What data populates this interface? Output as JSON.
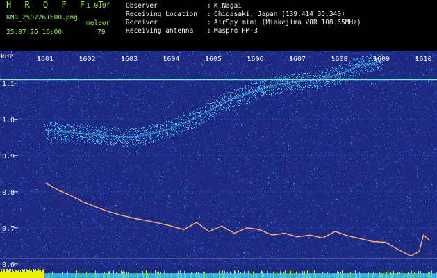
{
  "header": {
    "app_title": "H R O F F T",
    "app_version": "1.0.0f",
    "file_name": "KN9_2507261600.png",
    "mode_label": "meleor",
    "date_time": "25.07.26 16:00",
    "count_value": "79"
  },
  "meta": [
    {
      "label": "Observer",
      "value": "K.Nagai"
    },
    {
      "label": "Receiving Location",
      "value": "Chigasaki, Japan (139.414 35.340)"
    },
    {
      "label": "Receiver",
      "value": "AirSpy mini (Miakejima VOR 108.65MHz)"
    },
    {
      "label": "Receiving antenna",
      "value": "Maspro FM-3"
    }
  ],
  "colors": {
    "background": "#1c2a82",
    "text_green": "#9ef05a",
    "text_white": "#f2f2f2",
    "carrier_line": "#6ff0c8",
    "level_bar": "#e6f000"
  },
  "chart_data": {
    "type": "heatmap",
    "yunit": "kHz",
    "x": [
      "1601",
      "1602",
      "1603",
      "1604",
      "1605",
      "1606",
      "1607",
      "1608",
      "1609",
      "1610"
    ],
    "y_ticks": [
      "1.1",
      "1.0",
      "0.9",
      "0.8",
      "0.7",
      "0.6"
    ],
    "ylim": [
      0.59,
      1.19
    ],
    "carrier_freq": 1.11,
    "doppler_trace": [
      [
        1601.0,
        0.825
      ],
      [
        1601.3,
        0.805
      ],
      [
        1601.6,
        0.79
      ],
      [
        1601.9,
        0.772
      ],
      [
        1602.2,
        0.758
      ],
      [
        1602.5,
        0.745
      ],
      [
        1602.8,
        0.735
      ],
      [
        1603.1,
        0.727
      ],
      [
        1603.4,
        0.72
      ],
      [
        1603.7,
        0.713
      ],
      [
        1604.0,
        0.705
      ],
      [
        1604.3,
        0.695
      ],
      [
        1604.6,
        0.715
      ],
      [
        1604.9,
        0.69
      ],
      [
        1605.2,
        0.705
      ],
      [
        1605.5,
        0.685
      ],
      [
        1605.8,
        0.7
      ],
      [
        1606.1,
        0.695
      ],
      [
        1606.4,
        0.68
      ],
      [
        1606.7,
        0.685
      ],
      [
        1607.0,
        0.675
      ],
      [
        1607.3,
        0.68
      ],
      [
        1607.6,
        0.672
      ],
      [
        1607.9,
        0.69
      ],
      [
        1608.2,
        0.678
      ],
      [
        1608.5,
        0.67
      ],
      [
        1608.8,
        0.662
      ],
      [
        1609.1,
        0.66
      ],
      [
        1609.4,
        0.64
      ],
      [
        1609.7,
        0.622
      ],
      [
        1609.9,
        0.635
      ],
      [
        1610.0,
        0.68
      ],
      [
        1610.15,
        0.665
      ]
    ],
    "upper_trace": [
      [
        1601.0,
        0.97
      ],
      [
        1601.5,
        0.965
      ],
      [
        1602.0,
        0.96
      ],
      [
        1602.5,
        0.955
      ],
      [
        1603.0,
        0.95
      ],
      [
        1603.5,
        0.96
      ],
      [
        1604.0,
        0.975
      ],
      [
        1604.5,
        1.0
      ],
      [
        1605.0,
        1.03
      ],
      [
        1605.5,
        1.06
      ],
      [
        1606.0,
        1.08
      ],
      [
        1606.5,
        1.095
      ],
      [
        1607.0,
        1.105
      ],
      [
        1607.5,
        1.11
      ],
      [
        1608.0,
        1.125
      ],
      [
        1608.5,
        1.15
      ],
      [
        1609.0,
        1.16
      ]
    ]
  }
}
